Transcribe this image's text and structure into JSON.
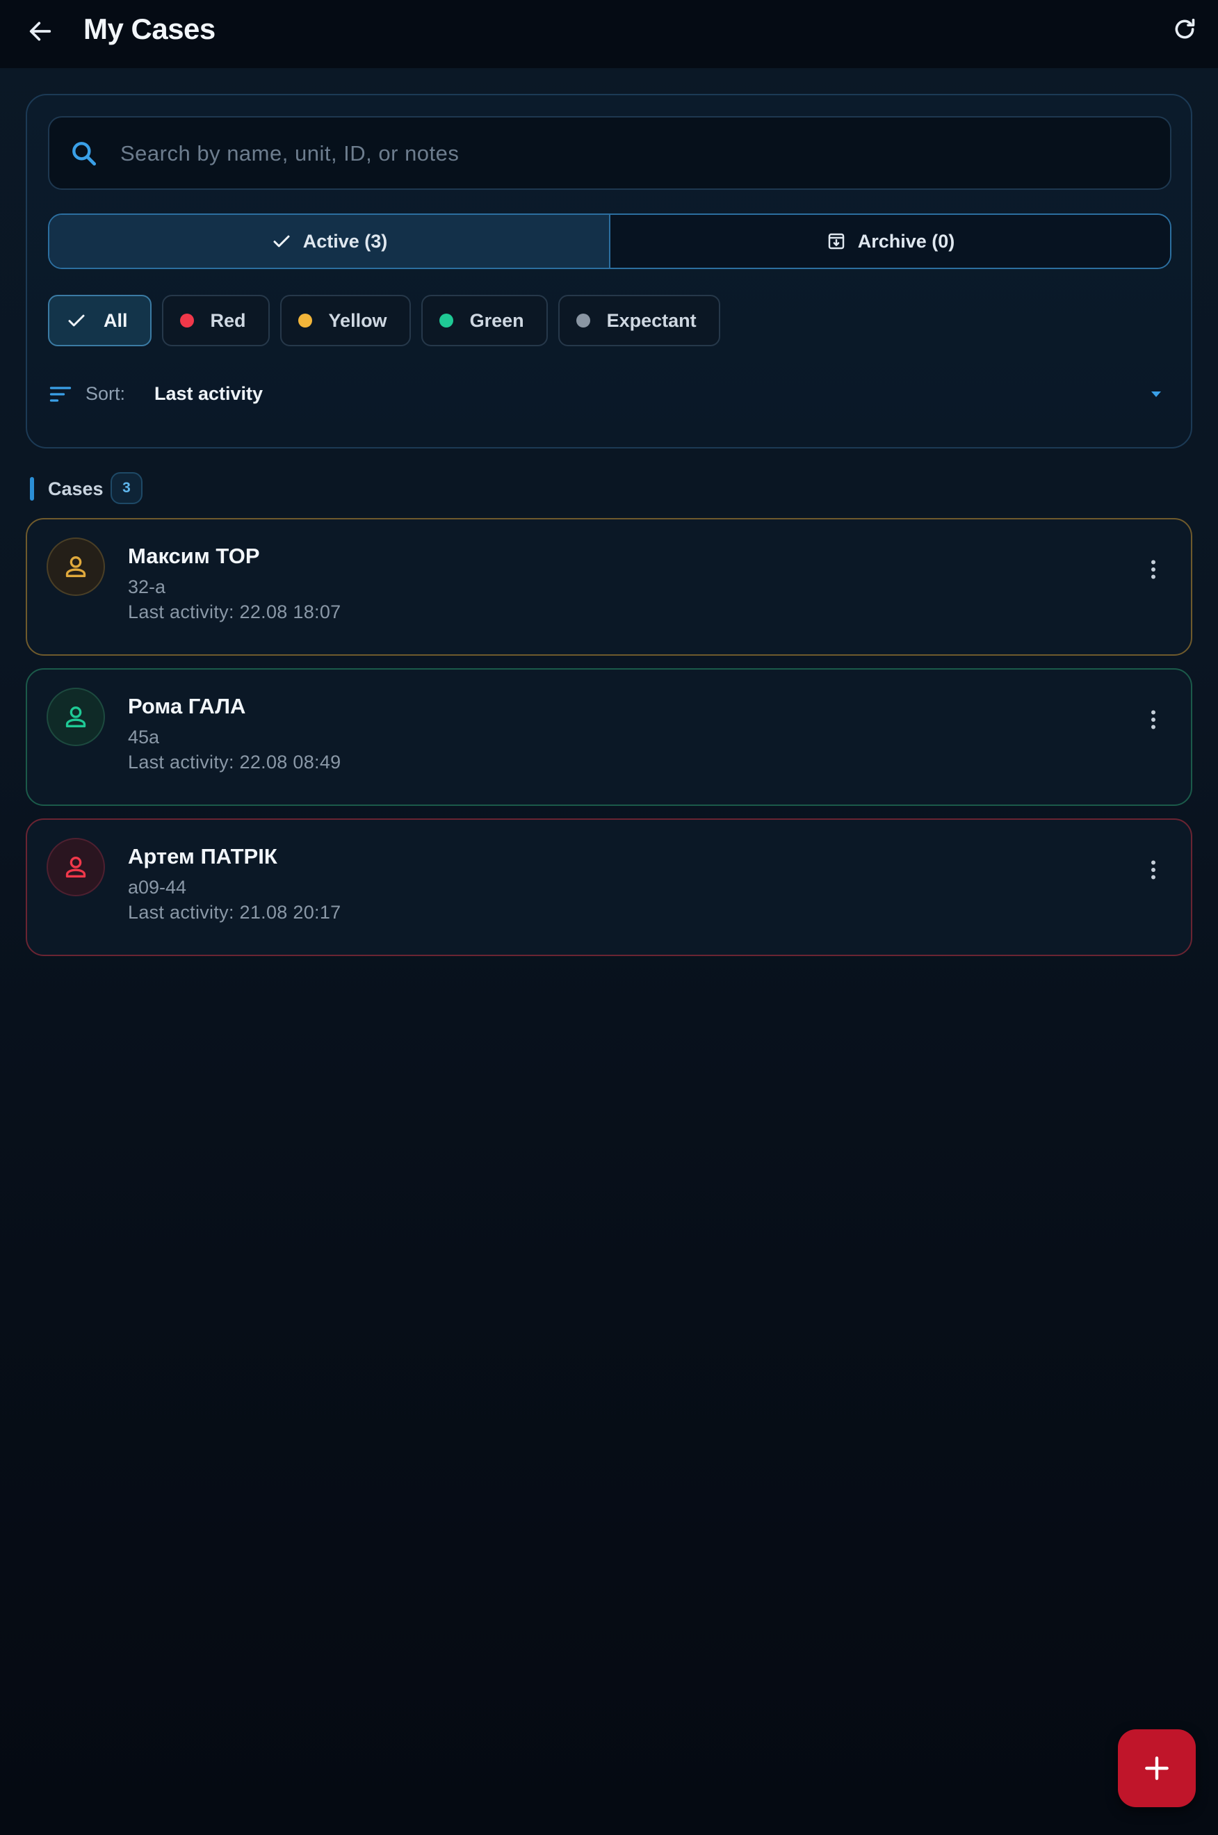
{
  "appbar": {
    "title": "My Cases",
    "back_icon": "arrow-left-icon",
    "refresh_icon": "refresh-icon"
  },
  "search": {
    "placeholder": "Search by name, unit, ID, or notes",
    "value": ""
  },
  "tabs": [
    {
      "label": "Active (3)",
      "selected": true,
      "icon": "check-icon"
    },
    {
      "label": "Archive (0)",
      "selected": false,
      "icon": "archive-box-icon"
    }
  ],
  "filters": [
    {
      "label": "All",
      "selected": true,
      "color": "#ffffff"
    },
    {
      "label": "Red",
      "selected": false,
      "color": "#f0384a"
    },
    {
      "label": "Yellow",
      "selected": false,
      "color": "#f2b53a"
    },
    {
      "label": "Green",
      "selected": false,
      "color": "#1fc995"
    },
    {
      "label": "Expectant",
      "selected": false,
      "color": "#8a96a3"
    }
  ],
  "sort": {
    "label": "Sort:",
    "value": "Last activity"
  },
  "cases_section": {
    "label": "Cases",
    "count": "3"
  },
  "cases": [
    {
      "name": "Максим TOP",
      "unit": "32-a",
      "activity": "Last activity: 22.08 18:07",
      "color": "#d6a13a"
    },
    {
      "name": "Рома ГАЛА",
      "unit": "45a",
      "activity": "Last activity: 22.08 08:49",
      "color": "#1fb888"
    },
    {
      "name": "Артем ПАТРІК",
      "unit": "a09-44",
      "activity": "Last activity: 21.08 20:17",
      "color": "#e0344a"
    }
  ],
  "fab": {
    "icon": "plus-icon",
    "color": "#c0152a"
  }
}
